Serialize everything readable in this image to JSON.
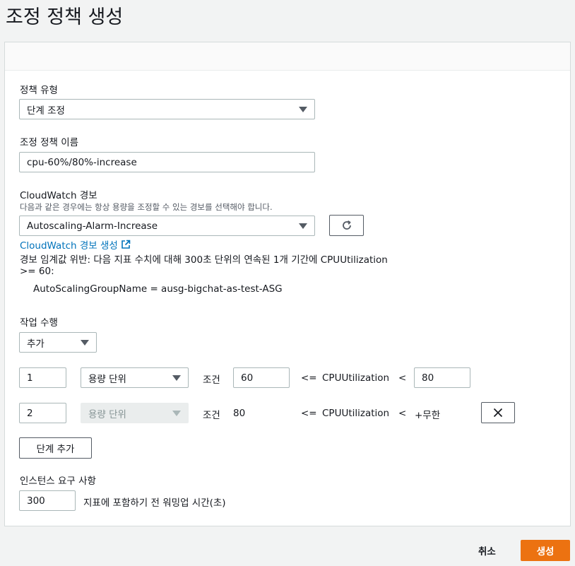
{
  "page": {
    "title": "조정 정책 생성"
  },
  "form": {
    "policy_type": {
      "label": "정책 유형",
      "value": "단계 조정"
    },
    "policy_name": {
      "label": "조정 정책 이름",
      "value": "cpu-60%/80%-increase"
    },
    "cloudwatch_alarm": {
      "label": "CloudWatch 경보",
      "description": "다음과 같은 경우에는 항상 용량을 조정할 수 있는 경보를 선택해야 합니다.",
      "value": "Autoscaling-Alarm-Increase",
      "create_link": "CloudWatch 경보 생성",
      "breach_line1": "경보 임계값 위반: 다음 지표 수치에 대해 300초 단위의 연속된 1개 기간에 CPUUtilization",
      "breach_line2": ">= 60:",
      "dimension": "AutoScalingGroupName = ausg-bigchat-as-test-ASG"
    },
    "action": {
      "label": "작업 수행",
      "value": "추가"
    },
    "steps": [
      {
        "amount": "1",
        "unit": "용량 단위",
        "cond": "조건",
        "lower": "60",
        "op1": "<=",
        "metric": "CPUUtilization",
        "op2": "<",
        "upper": "80"
      },
      {
        "amount": "2",
        "unit": "용량 단위",
        "cond": "조건",
        "lower": "80",
        "op1": "<=",
        "metric": "CPUUtilization",
        "op2": "<",
        "upper": "+무한"
      }
    ],
    "add_step_label": "단계 추가",
    "instance_req": {
      "label": "인스턴스 요구 사항",
      "value": "300",
      "suffix": "지표에 포함하기 전 워밍업 시간(초)"
    }
  },
  "footer": {
    "cancel": "취소",
    "create": "생성"
  },
  "colors": {
    "primary": "#ec7211",
    "link": "#0073bb"
  }
}
